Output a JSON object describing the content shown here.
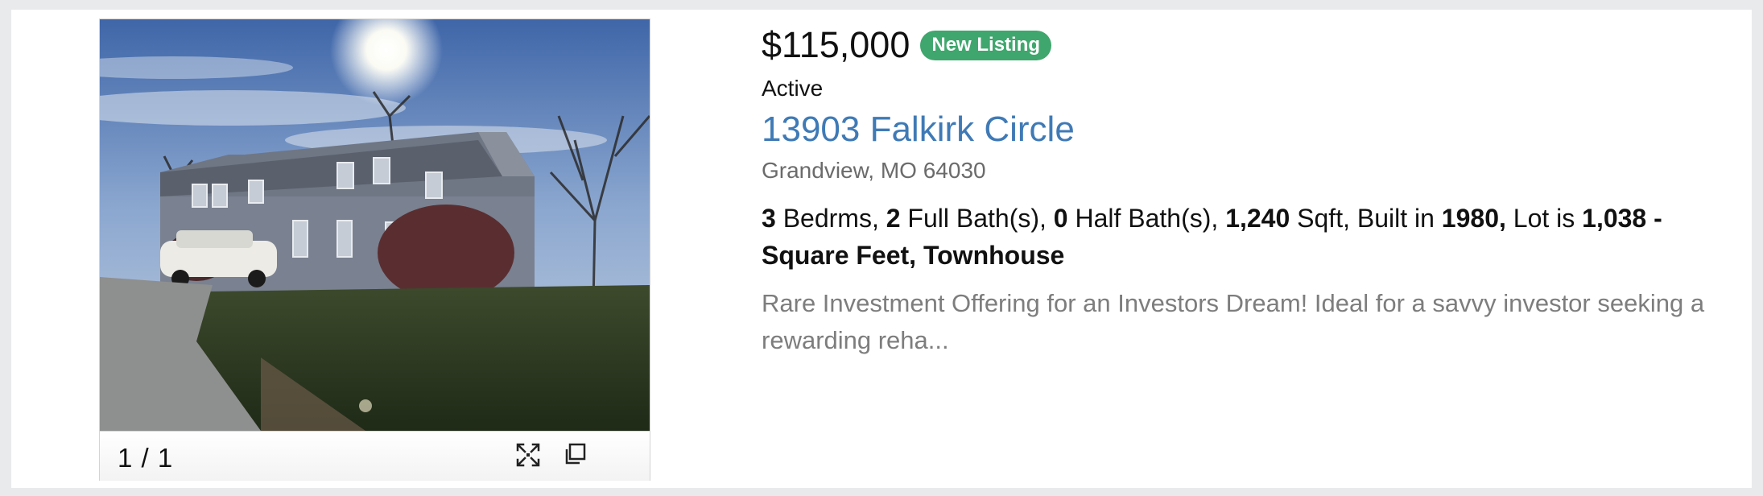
{
  "listing": {
    "price": "$115,000",
    "badge": "New Listing",
    "status": "Active",
    "address": "13903 Falkirk Circle",
    "city_state_zip": "Grandview, MO 64030",
    "facts": {
      "beds": "3",
      "beds_label": " Bedrms, ",
      "full_baths": "2",
      "full_baths_label": " Full Bath(s), ",
      "half_baths": "0",
      "half_baths_label": " Half Bath(s), ",
      "sqft": "1,240",
      "sqft_label": " Sqft, Built in ",
      "year_built": "1980,",
      "lot_label": " Lot is ",
      "lot_size": "1,038 - Square Feet, Townhouse"
    },
    "description": "Rare Investment Offering for an Investors Dream! Ideal for a savvy investor seeking a rewarding reha..."
  },
  "gallery": {
    "counter": "1 / 1",
    "fullscreen_icon": "fullscreen-icon",
    "popout_icon": "popout-icon"
  },
  "colors": {
    "page_bg": "#e9eaec",
    "badge_green": "#3fa66d",
    "link_blue": "#3f7ab6",
    "muted_text": "#7d7d7d"
  }
}
